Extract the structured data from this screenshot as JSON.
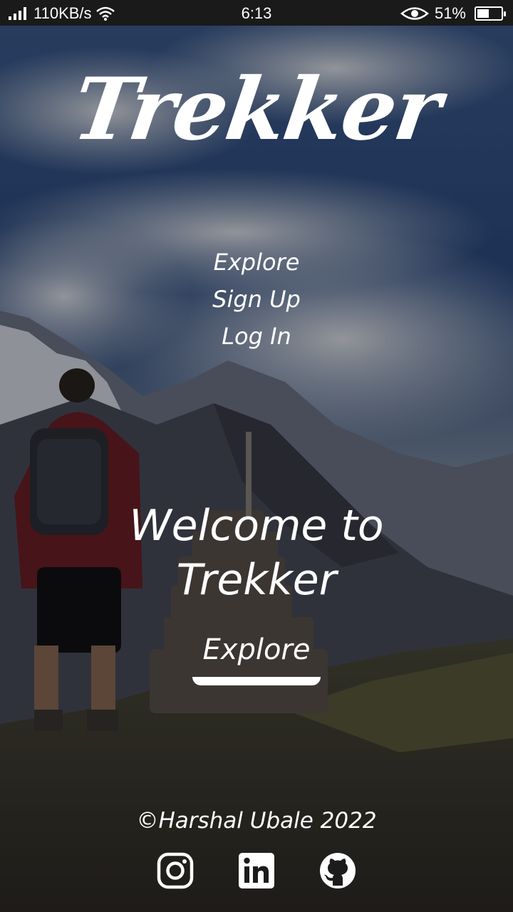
{
  "status_bar": {
    "network_speed": "110KB/s",
    "time": "6:13",
    "battery_percent": "51%",
    "battery_level": 0.51,
    "icons": [
      "signal-icon",
      "wifi-icon",
      "eye-icon",
      "battery-icon"
    ]
  },
  "brand": {
    "logo_text": "Trekker"
  },
  "nav": {
    "items": [
      {
        "label": "Explore"
      },
      {
        "label": "Sign Up"
      },
      {
        "label": "Log In"
      }
    ]
  },
  "hero": {
    "welcome_line1": "Welcome to",
    "welcome_line2": "Trekker",
    "cta_label": "Explore"
  },
  "footer": {
    "copyright": "©Harshal Ubale 2022",
    "social_icons": [
      "instagram-icon",
      "linkedin-icon",
      "github-icon"
    ]
  },
  "colors": {
    "text": "#ffffff",
    "status_bar_bg": "#1a1a1a",
    "sky": "#2a4a78",
    "mountain": "#3a3a44"
  }
}
